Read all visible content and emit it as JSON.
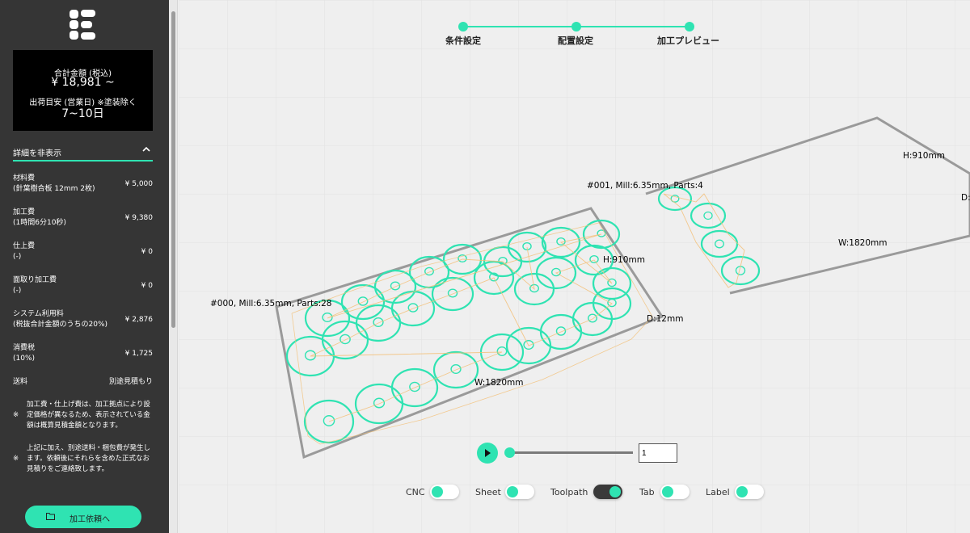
{
  "sidebar": {
    "total_label": "合計金額 (税込)",
    "total_value": "¥ 18,981 ~",
    "ship_label": "出荷目安 (営業日) ※塗装除く",
    "ship_value": "7~10日",
    "toggle_label": "詳細を非表示",
    "costs": [
      {
        "label": "材料費",
        "sub": "(針葉樹合板 12mm 2枚)",
        "value": "¥ 5,000"
      },
      {
        "label": "加工費",
        "sub": "(1時間6分10秒)",
        "value": "¥ 9,380"
      },
      {
        "label": "仕上費",
        "sub": "(-)",
        "value": "¥ 0"
      },
      {
        "label": "面取り加工費",
        "sub": "(-)",
        "value": "¥ 0"
      },
      {
        "label": "システム利用料",
        "sub": "(税抜合計金額のうちの20%)",
        "value": "¥ 2,876"
      },
      {
        "label": "消費税",
        "sub": "(10%)",
        "value": "¥ 1,725"
      },
      {
        "label": "送料",
        "sub": "",
        "value": "別途見積もり"
      }
    ],
    "notes": [
      {
        "mark": "※",
        "text": "加工費・仕上げ費は、加工拠点により設定価格が異なるため、表示されている金額は概算見積金額となります。"
      },
      {
        "mark": "※",
        "text": "上記に加え、別途送料・梱包費が発生します。依頼後にそれらを含めた正式なお見積りをご連絡致します。"
      }
    ],
    "order_button": "加工依頼へ"
  },
  "steps": [
    "条件設定",
    "配置設定",
    "加工プレビュー"
  ],
  "scene": {
    "sheet0_label": "#000, Mill:6.35mm, Parts:28",
    "sheet0_height": "H:910mm",
    "sheet0_depth": "D:12mm",
    "sheet0_width": "W:1820mm",
    "sheet1_label": "#001, Mill:6.35mm, Parts:4",
    "sheet1_height": "H:910mm",
    "sheet1_depth": "D:",
    "sheet1_width": "W:1820mm",
    "accent_color": "#2fe3b2",
    "path_color": "#f3c078"
  },
  "player": {
    "play_icon": "play-icon",
    "frame_value": "1"
  },
  "toggles": [
    {
      "label": "CNC",
      "on": false
    },
    {
      "label": "Sheet",
      "on": false
    },
    {
      "label": "Toolpath",
      "on": true
    },
    {
      "label": "Tab",
      "on": false
    },
    {
      "label": "Label",
      "on": false
    }
  ]
}
